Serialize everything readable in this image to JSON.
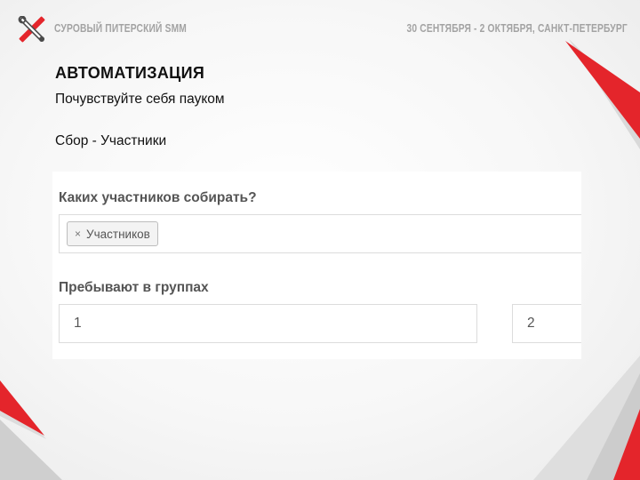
{
  "header": {
    "brand": "СУРОВЫЙ ПИТЕРСКИЙ SMM",
    "event": "30 СЕНТЯБРЯ - 2 ОКТЯБРЯ, САНКТ-ПЕТЕРБУРГ"
  },
  "slide": {
    "title": "АВТОМАТИЗАЦИЯ",
    "subtitle": "Почувствуйте себя пауком",
    "section": "Сбор - Участники"
  },
  "form": {
    "collect_label": "Каких участников собирать?",
    "collect_tag": "Участников",
    "tag_remove_glyph": "×",
    "groups_label": "Пребывают в группах",
    "groups_min": "1",
    "groups_max": "2"
  },
  "colors": {
    "accent": "#e4252b",
    "header_text": "#a3a3a3"
  }
}
